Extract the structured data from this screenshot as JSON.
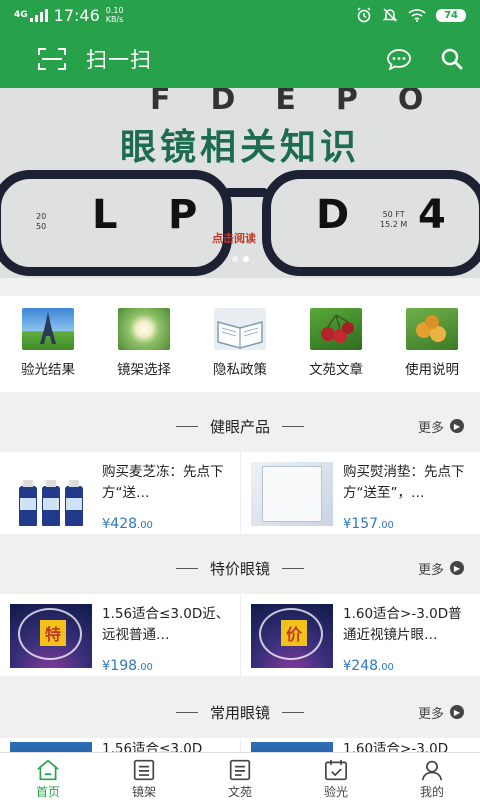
{
  "status_bar": {
    "network": "4G",
    "time": "17:46",
    "speed_value": "0.10",
    "speed_unit": "KB/s",
    "battery": "74"
  },
  "header": {
    "title": "扫一扫",
    "icons": [
      "scan-icon",
      "chat-icon",
      "search-icon"
    ]
  },
  "banner": {
    "headline": "眼镜相关知识",
    "chart_letters": [
      "L",
      "P",
      "D",
      "4"
    ],
    "acuity_left_top": "20",
    "acuity_left_bottom": "50",
    "acuity_right_top": "50 FT",
    "acuity_right_bottom": "15.2 M",
    "read_label": "点击阅读",
    "slide_count": 2,
    "active_slide": 1
  },
  "quick_menu": [
    {
      "label": "验光结果",
      "icon": "eiffel-tower-image",
      "color": "#4a8fd6"
    },
    {
      "label": "镜架选择",
      "icon": "lotus-image",
      "color": "#7fb35a"
    },
    {
      "label": "隐私政策",
      "icon": "open-book-image",
      "color": "#9bb7c9"
    },
    {
      "label": "文苑文章",
      "icon": "cherries-image",
      "color": "#a82a2a"
    },
    {
      "label": "使用说明",
      "icon": "fruit-image",
      "color": "#e0a232"
    }
  ],
  "sections": [
    {
      "title": "健眼产品",
      "more": "更多",
      "products": [
        {
          "name": "购买麦芝冻：先点下方“送…",
          "currency": "¥",
          "price_int": "428",
          "price_dec": ".00",
          "image": "bottles-image"
        },
        {
          "name": "购买熨消垫：先点下方“送至”，…",
          "currency": "¥",
          "price_int": "157",
          "price_dec": ".00",
          "image": "package-image"
        }
      ]
    },
    {
      "title": "特价眼镜",
      "more": "更多",
      "products": [
        {
          "name": "1.56适合≤3.0D近、远视普通…",
          "currency": "¥",
          "price_int": "198",
          "price_dec": ".00",
          "image": "lens-image",
          "badge": "特"
        },
        {
          "name": "1.60适合>-3.0D普通近视镜片眼…",
          "currency": "¥",
          "price_int": "248",
          "price_dec": ".00",
          "image": "lens-image",
          "badge": "价"
        }
      ]
    },
    {
      "title": "常用眼镜",
      "more": "更多",
      "products": [
        {
          "name": "1.56适合≤3.0D",
          "image": "lens-image"
        },
        {
          "name": "1.60适合>-3.0D",
          "image": "lens-image"
        }
      ]
    }
  ],
  "tabbar": [
    {
      "label": "首页",
      "icon": "home-icon",
      "active": true
    },
    {
      "label": "镜架",
      "icon": "list-icon",
      "active": false
    },
    {
      "label": "文苑",
      "icon": "document-icon",
      "active": false
    },
    {
      "label": "验光",
      "icon": "calendar-icon",
      "active": false
    },
    {
      "label": "我的",
      "icon": "user-icon",
      "active": false
    }
  ],
  "colors": {
    "brand_green": "#27a24b",
    "price_blue": "#2e78c0",
    "section_bg": "#f0f0f0"
  }
}
